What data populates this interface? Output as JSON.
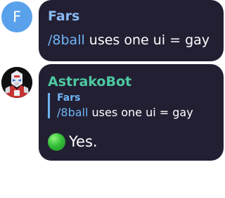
{
  "messages": [
    {
      "sender": "Fars",
      "sender_color": "#8ab9f1",
      "avatar_letter": "F",
      "avatar_color": "#5aa1ec",
      "command": "/8ball",
      "text": " uses one ui = gay"
    },
    {
      "sender": "AstrakoBot",
      "sender_color": "#4dc9a1",
      "avatar_icon": "robot-avatar-icon",
      "reply": {
        "sender": "Fars",
        "command": "/8ball",
        "text": " uses one ui = gay"
      },
      "answer_icon": "green-circle-icon",
      "answer": "Yes."
    }
  ],
  "colors": {
    "bubble": "#221f33",
    "link": "#6fb5f3",
    "text": "#ffffff"
  }
}
